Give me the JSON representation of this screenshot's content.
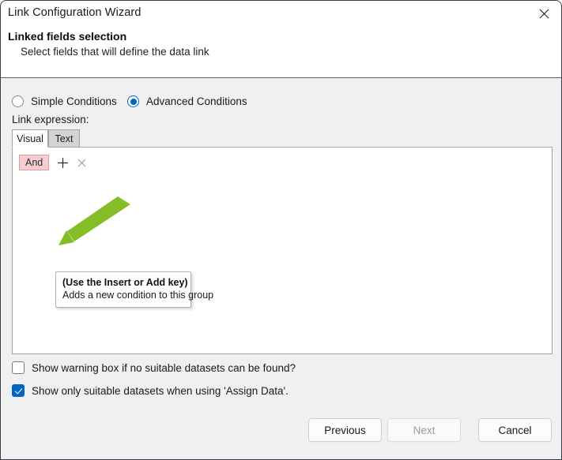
{
  "window": {
    "title": "Link Configuration Wizard",
    "close_icon": "close-icon"
  },
  "header": {
    "heading": "Linked fields selection",
    "subheading": "Select fields that will define the data link"
  },
  "conditions": {
    "options": [
      {
        "label": "Simple Conditions",
        "selected": false
      },
      {
        "label": "Advanced Conditions",
        "selected": true
      }
    ],
    "selected_value": "Advanced Conditions"
  },
  "link_expression": {
    "label": "Link expression:",
    "tabs": [
      {
        "label": "Visual",
        "selected": true
      },
      {
        "label": "Text",
        "selected": false
      }
    ],
    "group": {
      "operator_label": "And",
      "add_icon": "plus-icon",
      "remove_icon": "close-small-icon"
    }
  },
  "tooltip": {
    "title": "(Use the Insert or Add key)",
    "description": "Adds a new condition to this group"
  },
  "annotation": {
    "arrow_color": "#84bd26",
    "arrow_icon": "green-pointer-arrow"
  },
  "checkboxes": [
    {
      "label": "Show warning box if no suitable datasets can be found?",
      "checked": false
    },
    {
      "label": "Show only suitable datasets when using 'Assign Data'.",
      "checked": true
    }
  ],
  "footer": {
    "previous_label": "Previous",
    "next_label": "Next",
    "cancel_label": "Cancel",
    "next_enabled": false
  },
  "colors": {
    "accent": "#0067c0",
    "window_background": "#f0f0f0",
    "header_background": "#ffffff",
    "chip_background": "#f6cdd1",
    "chip_border": "#e39ba3",
    "annotation_green": "#84bd26"
  }
}
